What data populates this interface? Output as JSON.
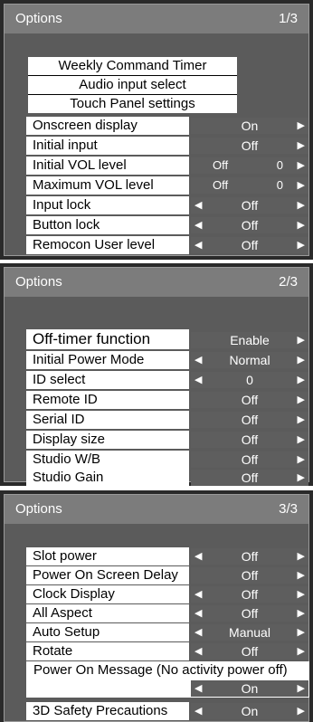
{
  "panel1": {
    "title": "Options",
    "page": "1/3",
    "links": [
      "Weekly Command Timer",
      "Audio input select",
      "Touch Panel settings"
    ],
    "rows": [
      {
        "label": "Onscreen display",
        "value": "On"
      },
      {
        "label": "Initial input",
        "value": "Off"
      },
      {
        "label": "Initial VOL level",
        "value": "Off",
        "extra": "0"
      },
      {
        "label": "Maximum VOL level",
        "value": "Off",
        "extra": "0"
      },
      {
        "label": "Input lock",
        "value": "Off"
      },
      {
        "label": "Button lock",
        "value": "Off"
      },
      {
        "label": "Remocon User level",
        "value": "Off"
      }
    ]
  },
  "panel2": {
    "title": "Options",
    "page": "2/3",
    "rows": [
      {
        "label": "Off-timer function",
        "value": "Enable"
      },
      {
        "label": "Initial Power Mode",
        "value": "Normal"
      },
      {
        "label": "ID select",
        "value": "0"
      },
      {
        "label": "Remote ID",
        "value": "Off"
      },
      {
        "label": "Serial ID",
        "value": "Off"
      },
      {
        "label": "Display size",
        "value": "Off"
      },
      {
        "label": "Studio W/B",
        "value": "Off"
      },
      {
        "label": "Studio Gain",
        "value": "Off"
      }
    ]
  },
  "panel3": {
    "title": "Options",
    "page": "3/3",
    "rows": [
      {
        "label": "Slot power",
        "value": "Off"
      },
      {
        "label": "Power On Screen Delay",
        "value": "Off"
      },
      {
        "label": "Clock Display",
        "value": "Off"
      },
      {
        "label": "All Aspect",
        "value": "Off"
      },
      {
        "label": "Auto Setup",
        "value": "Manual"
      },
      {
        "label": "Rotate",
        "value": "Off"
      }
    ],
    "power_msg_label": "Power On Message (No activity power off)",
    "power_msg_value": "On",
    "safety_label": "3D Safety Precautions",
    "safety_value": "On"
  }
}
